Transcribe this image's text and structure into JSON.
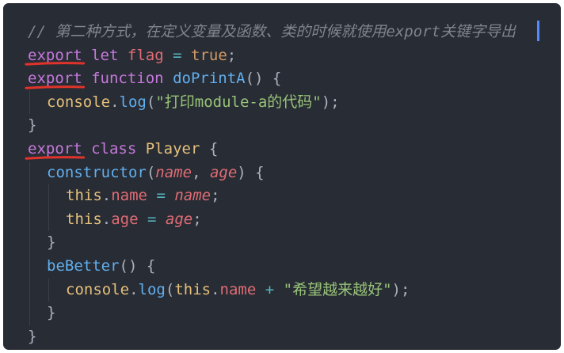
{
  "editor": {
    "lines": [
      {
        "tokens": [
          {
            "t": "// 第二种方式，在定义变量及函数、类的时候就使用export关键字导出",
            "k": "comment"
          }
        ]
      },
      {
        "tokens": [
          {
            "t": "export",
            "k": "export"
          },
          {
            "t": " ",
            "k": "punc"
          },
          {
            "t": "let",
            "k": "kw"
          },
          {
            "t": " ",
            "k": "punc"
          },
          {
            "t": "flag",
            "k": "var"
          },
          {
            "t": " ",
            "k": "punc"
          },
          {
            "t": "=",
            "k": "op"
          },
          {
            "t": " ",
            "k": "punc"
          },
          {
            "t": "true",
            "k": "bool"
          },
          {
            "t": ";",
            "k": "punc"
          }
        ]
      },
      {
        "tokens": [
          {
            "t": "export",
            "k": "export"
          },
          {
            "t": " ",
            "k": "punc"
          },
          {
            "t": "function",
            "k": "kw"
          },
          {
            "t": " ",
            "k": "punc"
          },
          {
            "t": "doPrintA",
            "k": "fn"
          },
          {
            "t": "() {",
            "k": "punc"
          }
        ]
      },
      {
        "indent": 1,
        "tokens": [
          {
            "t": "console",
            "k": "obj"
          },
          {
            "t": ".",
            "k": "punc"
          },
          {
            "t": "log",
            "k": "fn"
          },
          {
            "t": "(",
            "k": "punc"
          },
          {
            "t": "\"打印module-a的代码\"",
            "k": "str"
          },
          {
            "t": ");",
            "k": "punc"
          }
        ]
      },
      {
        "tokens": [
          {
            "t": "}",
            "k": "punc"
          }
        ]
      },
      {
        "tokens": [
          {
            "t": "export",
            "k": "export"
          },
          {
            "t": " ",
            "k": "punc"
          },
          {
            "t": "class",
            "k": "kw"
          },
          {
            "t": " ",
            "k": "punc"
          },
          {
            "t": "Player",
            "k": "cls"
          },
          {
            "t": " {",
            "k": "punc"
          }
        ]
      },
      {
        "indent": 1,
        "tokens": [
          {
            "t": "constructor",
            "k": "fn"
          },
          {
            "t": "(",
            "k": "punc"
          },
          {
            "t": "name",
            "k": "param"
          },
          {
            "t": ", ",
            "k": "punc"
          },
          {
            "t": "age",
            "k": "param"
          },
          {
            "t": ") {",
            "k": "punc"
          }
        ]
      },
      {
        "indent": 2,
        "tokens": [
          {
            "t": "this",
            "k": "obj"
          },
          {
            "t": ".",
            "k": "punc"
          },
          {
            "t": "name",
            "k": "prop"
          },
          {
            "t": " ",
            "k": "punc"
          },
          {
            "t": "=",
            "k": "op"
          },
          {
            "t": " ",
            "k": "punc"
          },
          {
            "t": "name",
            "k": "param"
          },
          {
            "t": ";",
            "k": "punc"
          }
        ]
      },
      {
        "indent": 2,
        "tokens": [
          {
            "t": "this",
            "k": "obj"
          },
          {
            "t": ".",
            "k": "punc"
          },
          {
            "t": "age",
            "k": "prop"
          },
          {
            "t": " ",
            "k": "punc"
          },
          {
            "t": "=",
            "k": "op"
          },
          {
            "t": " ",
            "k": "punc"
          },
          {
            "t": "age",
            "k": "param"
          },
          {
            "t": ";",
            "k": "punc"
          }
        ]
      },
      {
        "indent": 1,
        "tokens": [
          {
            "t": "}",
            "k": "punc"
          }
        ]
      },
      {
        "indent": 1,
        "tokens": [
          {
            "t": "beBetter",
            "k": "fn"
          },
          {
            "t": "() {",
            "k": "punc"
          }
        ]
      },
      {
        "indent": 2,
        "tokens": [
          {
            "t": "console",
            "k": "obj"
          },
          {
            "t": ".",
            "k": "punc"
          },
          {
            "t": "log",
            "k": "fn"
          },
          {
            "t": "(",
            "k": "punc"
          },
          {
            "t": "this",
            "k": "obj"
          },
          {
            "t": ".",
            "k": "punc"
          },
          {
            "t": "name",
            "k": "prop"
          },
          {
            "t": " ",
            "k": "punc"
          },
          {
            "t": "+",
            "k": "op"
          },
          {
            "t": " ",
            "k": "punc"
          },
          {
            "t": "\"希望越来越好\"",
            "k": "str"
          },
          {
            "t": ");",
            "k": "punc"
          }
        ]
      },
      {
        "indent": 1,
        "tokens": [
          {
            "t": "}",
            "k": "punc"
          }
        ]
      },
      {
        "tokens": [
          {
            "t": "}",
            "k": "punc"
          }
        ]
      }
    ]
  },
  "colors": {
    "background": "#282c34",
    "annotation_underline": "#e0332b",
    "cursor": "#528bff"
  }
}
